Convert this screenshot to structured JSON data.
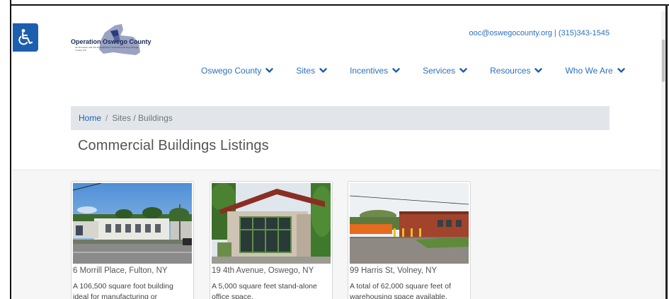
{
  "header": {
    "logo_name": "Operation Oswego County",
    "logo_tagline": "An Economic and Job Development Corporation Serving Oswego County, NY",
    "contact": "ooc@oswegocounty.org | (315)343-1545"
  },
  "nav": [
    {
      "label": "Oswego County",
      "icon": "chevron-down-icon"
    },
    {
      "label": "Sites",
      "icon": "chevron-down-icon"
    },
    {
      "label": "Incentives",
      "icon": "chevron-down-icon"
    },
    {
      "label": "Services",
      "icon": "chevron-down-icon"
    },
    {
      "label": "Resources",
      "icon": "chevron-down-icon"
    },
    {
      "label": "Who We Are",
      "icon": "chevron-down-icon"
    }
  ],
  "breadcrumb": {
    "home": "Home",
    "separator": "/",
    "current": "Sites / Buildings"
  },
  "page_title": "Commercial Buildings Listings",
  "listings": [
    {
      "address": "6 Morrill Place, Fulton, NY",
      "description": "A 106,500 square foot building ideal for manufacturing or"
    },
    {
      "address": "19 4th Avenue, Oswego, NY",
      "description": "A 5,000 square feet stand-alone office space."
    },
    {
      "address": "99 Harris St, Volney, NY",
      "description": "A total of 62,000 square feet of warehousing space available."
    }
  ],
  "colors": {
    "accent": "#2d6fc0",
    "accessibility_bg": "#1d5fae",
    "breadcrumb_bg": "#e2e6ea"
  }
}
